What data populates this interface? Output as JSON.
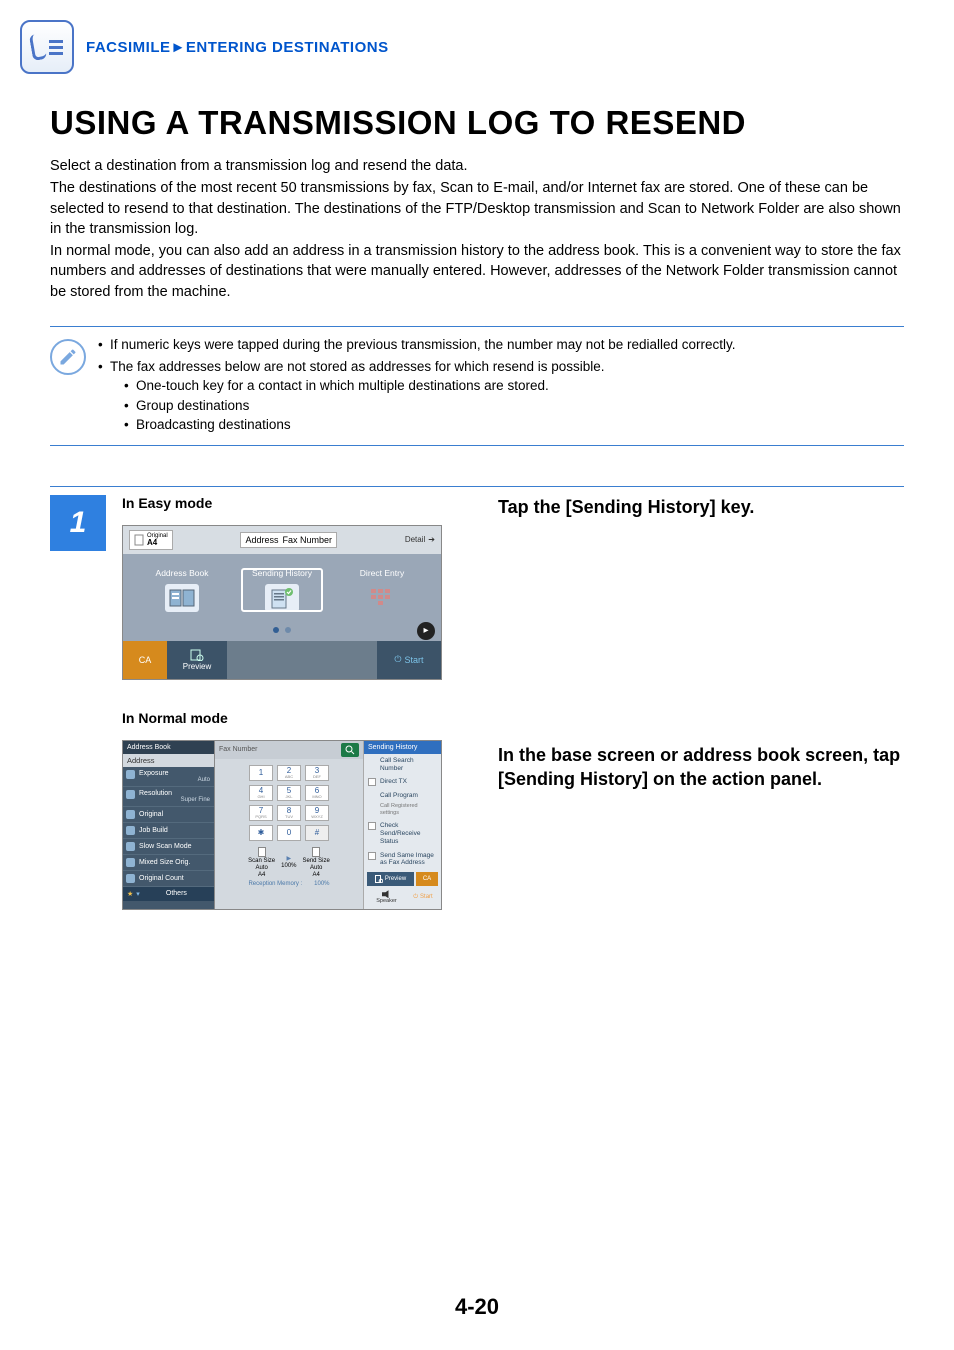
{
  "breadcrumb": {
    "section": "FACSIMILE",
    "sep": "►",
    "sub": "ENTERING DESTINATIONS"
  },
  "title": "USING A TRANSMISSION LOG TO RESEND",
  "intro": {
    "p1": "Select a destination from a transmission log and resend the data.",
    "p2": "The destinations of the most recent 50 transmissions by fax, Scan to E-mail, and/or Internet fax are stored. One of these can be selected to resend to that destination. The destinations of the FTP/Desktop transmission and Scan to Network Folder are also shown in the transmission log.",
    "p3": "In normal mode, you can also add an address in a transmission history to the address book. This is a convenient way to store the fax numbers and addresses of destinations that were manually entered. However, addresses of the Network Folder transmission cannot be stored from the machine."
  },
  "notes": {
    "b1": "If numeric keys were tapped during the previous transmission, the number may not be redialled correctly.",
    "b2": "The fax addresses below are not stored as addresses for which resend is possible.",
    "s1": "One-touch key for a contact in which multiple destinations are stored.",
    "s2": "Group destinations",
    "s3": "Broadcasting destinations"
  },
  "step": {
    "num": "1",
    "easy_label": "In Easy mode",
    "easy_instr": "Tap the [Sending History] key.",
    "normal_label": "In Normal mode",
    "normal_instr": "In the base screen or address book screen, tap [Sending History] on the action panel."
  },
  "easy": {
    "orig_lbl": "Original",
    "orig_val": "A4",
    "addr_lbl": "Address",
    "fax_lbl": "Fax Number",
    "detail": "Detail",
    "tab1": "Address Book",
    "tab2": "Sending History",
    "tab3": "Direct Entry",
    "ca": "CA",
    "preview": "Preview",
    "start": "Start"
  },
  "normal": {
    "hdr": "Address Book",
    "addr": "Address",
    "fax": "Fax Number",
    "left_items": [
      {
        "t": "Exposure",
        "s": "Auto"
      },
      {
        "t": "Resolution",
        "s": "Super Fine"
      },
      {
        "t": "Original",
        "s": ""
      },
      {
        "t": "Job Build",
        "s": ""
      },
      {
        "t": "Slow Scan Mode",
        "s": ""
      },
      {
        "t": "Mixed Size Orig.",
        "s": ""
      },
      {
        "t": "Original Count",
        "s": ""
      }
    ],
    "others": "Others",
    "keypad": [
      "1",
      "2",
      "3",
      "4",
      "5",
      "6",
      "7",
      "8",
      "9",
      "✱",
      "0",
      "#"
    ],
    "key_sub": [
      "",
      "ABC",
      "DEF",
      "GHI",
      "JKL",
      "MNO",
      "PQRS",
      "TUV",
      "WXYZ",
      "",
      "",
      ""
    ],
    "scan_size": "Scan Size",
    "send_size": "Send Size",
    "auto": "Auto",
    "a4": "A4",
    "pct": "100%",
    "mem_l": "Reception Memory :",
    "mem_r": "100%",
    "r_hdr": "Sending History",
    "actions": [
      {
        "t": "Call Search Number",
        "chk": false
      },
      {
        "t": "Direct TX",
        "chk": true
      },
      {
        "t": "Call Program",
        "chk": false
      },
      {
        "t": "Call Registered settings",
        "chk": false,
        "sub": true
      },
      {
        "t": "Check Send/Receive Status",
        "chk": true
      },
      {
        "t": "Send Same Image as Fax Address",
        "chk": true
      }
    ],
    "preview": "Preview",
    "ca": "CA",
    "speaker": "Speaker",
    "start": "Start"
  },
  "page_number": "4-20"
}
